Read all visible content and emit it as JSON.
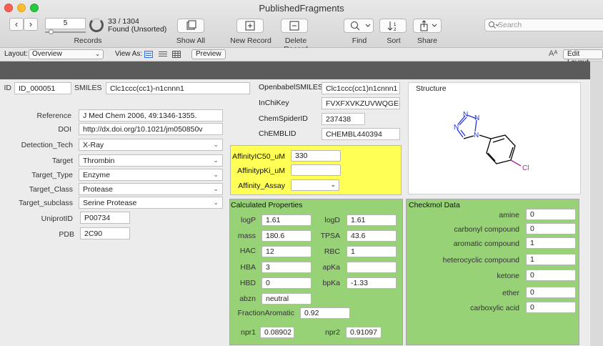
{
  "window": {
    "title": "PublishedFragments"
  },
  "toolbar": {
    "record_number": "5",
    "records_label": "Records",
    "count": "33 / 1304",
    "found_status": "Found (Unsorted)",
    "show_all": "Show All",
    "new_record": "New Record",
    "delete_record": "Delete Record",
    "find": "Find",
    "sort": "Sort",
    "share": "Share",
    "search_placeholder": "Search"
  },
  "layout_bar": {
    "layout_label": "Layout:",
    "layout_value": "Overview",
    "view_as_label": "View As:",
    "preview": "Preview",
    "edit_layout": "Edit Layout"
  },
  "record": {
    "id_label": "ID",
    "id": "ID_000051",
    "smiles_label": "SMILES",
    "smiles": "Clc1ccc(cc1)-n1cnnn1",
    "obsmiles_label": "OpenbabelSMILES",
    "obsmiles": "Clc1ccc(cc1)n1cnnn1",
    "inchikey_label": "InChiKey",
    "inchikey": "FVXFXVKZUVWQGE-",
    "chemspider_label": "ChemSpiderID",
    "chemspider": "237438",
    "chembl_label": "ChEMBLID",
    "chembl": "CHEMBL440394",
    "structure_label": "Structure",
    "reference_label": "Reference",
    "reference": "J Med Chem 2006, 49:1346-1355.",
    "doi_label": "DOI",
    "doi": "http://dx.doi.org/10.1021/jm050850v",
    "detection_label": "Detection_Tech",
    "detection": "X-Ray",
    "target_label": "Target",
    "target": "Thrombin",
    "target_type_label": "Target_Type",
    "target_type": "Enzyme",
    "target_class_label": "Target_Class",
    "target_class": "Protease",
    "target_subclass_label": "Target_subclass",
    "target_subclass": "Serine Protease",
    "uniprot_label": "UniprotID",
    "uniprot": "P00734",
    "pdb_label": "PDB",
    "pdb": "2C90"
  },
  "affinity": {
    "ic50_label": "AffinityIC50_uM",
    "ic50": "330",
    "ki_label": "AffinitypKi_uM",
    "ki": "",
    "assay_label": "Affinity_Assay",
    "assay": ""
  },
  "calc": {
    "title": "Calculated Properties",
    "logp_label": "logP",
    "logp": "1.61",
    "logd_label": "logD",
    "logd": "1.61",
    "mass_label": "mass",
    "mass": "180.6",
    "tpsa_label": "TPSA",
    "tpsa": "43.6",
    "hac_label": "HAC",
    "hac": "12",
    "rbc_label": "RBC",
    "rbc": "1",
    "hba_label": "HBA",
    "hba": "3",
    "apka_label": "apKa",
    "apka": "",
    "hbd_label": "HBD",
    "hbd": "0",
    "bpka_label": "bpKa",
    "bpka": "-1.33",
    "abzn_label": "abzn",
    "abzn": "neutral",
    "fa_label": "FractionAromatic",
    "fa": "0.92",
    "npr1_label": "npr1",
    "npr1": "0.08902",
    "npr2_label": "npr2",
    "npr2": "0.91097"
  },
  "checkmol": {
    "title": "Checkmol Data",
    "amine_label": "amine",
    "amine": "0",
    "carbonyl_label": "carbonyl compound",
    "carbonyl": "0",
    "aromatic_label": "aromatic compound",
    "aromatic": "1",
    "heterocyclic_label": "heterocyclic compound",
    "heterocyclic": "1",
    "ketone_label": "ketone",
    "ketone": "0",
    "ether_label": "ether",
    "ether": "0",
    "carboxylic_label": "carboxylic acid",
    "carboxylic": "0"
  },
  "molecule": {
    "n": "N",
    "cl": "Cl"
  },
  "colors": {
    "yellow_panel": "#ffff55",
    "green_panel": "#97d277",
    "band": "#5b5b5b",
    "nitrogen": "#2233dd",
    "chlorine": "#b0209a"
  },
  "icons": [
    "back-arrow-icon",
    "forward-arrow-icon",
    "progress-ring-icon",
    "show-all-icon",
    "new-record-icon",
    "delete-record-icon",
    "find-icon",
    "sort-icon",
    "share-icon",
    "search-icon",
    "form-view-icon",
    "list-view-icon",
    "table-view-icon",
    "text-size-icon"
  ]
}
